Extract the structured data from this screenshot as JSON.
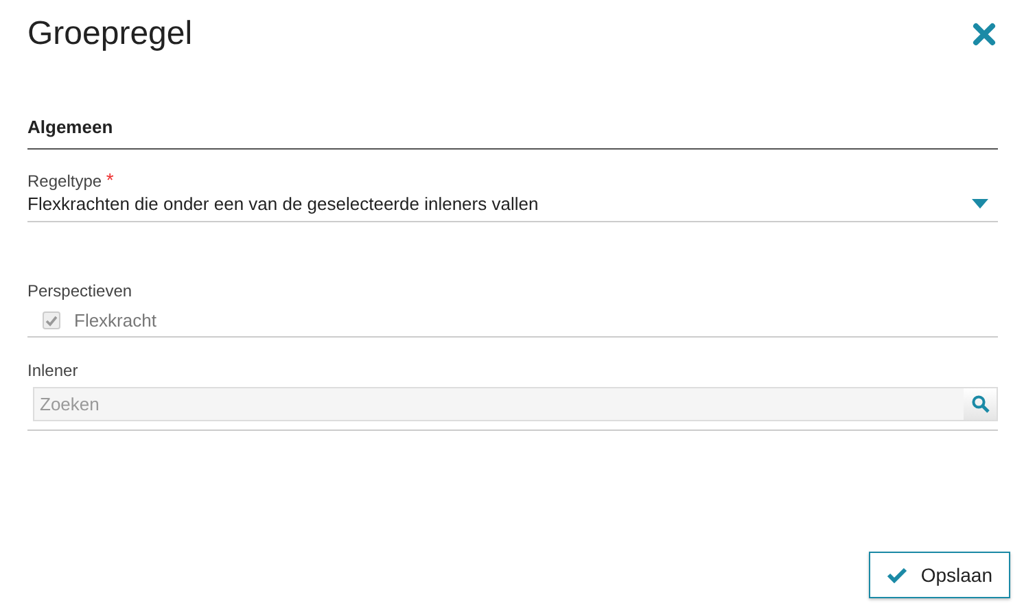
{
  "dialog": {
    "title": "Groepregel"
  },
  "section": {
    "title": "Algemeen"
  },
  "regeltype": {
    "label": "Regeltype",
    "required_mark": "*",
    "value": "Flexkrachten die onder een van de geselecteerde inleners vallen"
  },
  "perspectieven": {
    "label": "Perspectieven",
    "options": [
      {
        "label": "Flexkracht",
        "checked": true,
        "disabled": true
      }
    ]
  },
  "inlener": {
    "label": "Inlener",
    "placeholder": "Zoeken"
  },
  "buttons": [
    {
      "label": "Opslaan"
    }
  ]
}
